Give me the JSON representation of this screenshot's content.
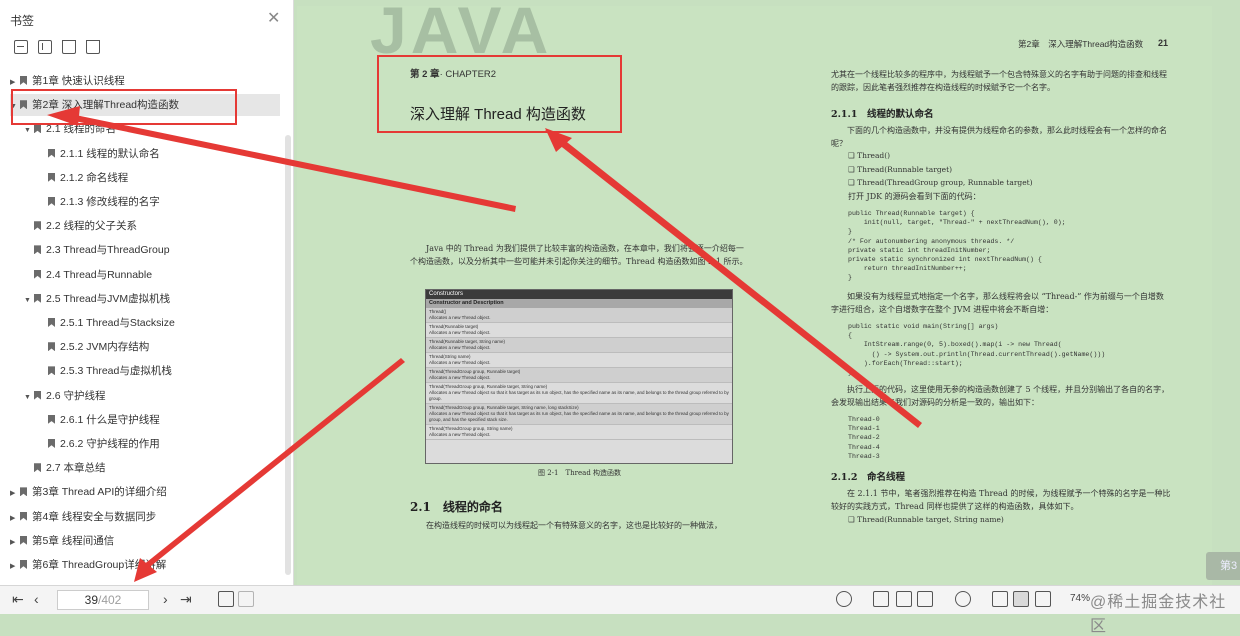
{
  "sidebar": {
    "title": "书签",
    "toc": [
      {
        "label": "第1章 快速认识线程",
        "level": 0,
        "expanded": false
      },
      {
        "label": "第2章 深入理解Thread构造函数",
        "level": 0,
        "expanded": true,
        "selected": true
      },
      {
        "label": "2.1 线程的命名",
        "level": 1,
        "expanded": true
      },
      {
        "label": "2.1.1 线程的默认命名",
        "level": 2
      },
      {
        "label": "2.1.2 命名线程",
        "level": 2
      },
      {
        "label": "2.1.3 修改线程的名字",
        "level": 2
      },
      {
        "label": "2.2 线程的父子关系",
        "level": 1
      },
      {
        "label": "2.3 Thread与ThreadGroup",
        "level": 1
      },
      {
        "label": "2.4 Thread与Runnable",
        "level": 1
      },
      {
        "label": "2.5 Thread与JVM虚拟机栈",
        "level": 1,
        "expanded": true
      },
      {
        "label": "2.5.1 Thread与Stacksize",
        "level": 2
      },
      {
        "label": "2.5.2 JVM内存结构",
        "level": 2
      },
      {
        "label": "2.5.3 Thread与虚拟机栈",
        "level": 2
      },
      {
        "label": "2.6 守护线程",
        "level": 1,
        "expanded": true
      },
      {
        "label": "2.6.1 什么是守护线程",
        "level": 2
      },
      {
        "label": "2.6.2 守护线程的作用",
        "level": 2
      },
      {
        "label": "2.7 本章总结",
        "level": 1
      },
      {
        "label": "第3章 Thread API的详细介绍",
        "level": 0,
        "expanded": false
      },
      {
        "label": "第4章 线程安全与数据同步",
        "level": 0,
        "expanded": false
      },
      {
        "label": "第5章 线程间通信",
        "level": 0,
        "expanded": false
      },
      {
        "label": "第6章 ThreadGroup详细讲解",
        "level": 0,
        "expanded": false
      }
    ]
  },
  "page": {
    "watermark": "JAVA",
    "running_head": "第2章　深入理解Thread构造函数",
    "page_number": "21",
    "chapter_label": "第 2 章",
    "chapter_en": "· CHAPTER2",
    "chapter_title": "深入理解 Thread 构造函数",
    "intro": "Java 中的 Thread 为我们提供了比较丰富的构造函数，在本章中，我们将会逐一介绍每一个构造函数，以及分析其中一些可能并未引起你关注的细节。Thread 构造函数如图 2-1 所示。",
    "figure": {
      "header": "Constructors",
      "subheader": "Constructor and Description",
      "rows": [
        "Thread()\nAllocates a new Thread object.",
        "Thread(Runnable target)\nAllocates a new Thread object.",
        "Thread(Runnable target, String name)\nAllocates a new Thread object.",
        "Thread(String name)\nAllocates a new Thread object.",
        "Thread(ThreadGroup group, Runnable target)\nAllocates a new Thread object.",
        "Thread(ThreadGroup group, Runnable target, String name)\nAllocates a new Thread object so that it has target as its run object, has the specified name as its name, and belongs to the thread group referred to by group.",
        "Thread(ThreadGroup group, Runnable target, String name, long stackSize)\nAllocates a new Thread object so that it has target as its run object, has the specified name as its name, and belongs to the thread group referred to by group, and has the specified stack size.",
        "Thread(ThreadGroup group, String name)\nAllocates a new Thread object."
      ],
      "caption": "图 2-1　Thread 构造函数"
    },
    "sec_2_1": "2.1　线程的命名",
    "sec_2_1_text": "在构造线程的时候可以为线程起一个有特殊意义的名字，这也是比较好的一种做法，",
    "right_intro": "尤其在一个线程比较多的程序中，为线程赋予一个包含特殊意义的名字有助于问题的排查和线程的跟踪，因此笔者强烈推荐在构造线程的时候赋予它一个名字。",
    "sec_2_1_1": "2.1.1　线程的默认命名",
    "sec_2_1_1_text": "下面的几个构造函数中，并没有提供为线程命名的参数，那么此时线程会有一个怎样的命名呢？",
    "bullets": [
      "Thread()",
      "Thread(Runnable target)",
      "Thread(ThreadGroup group, Runnable target)"
    ],
    "jdk_line": "打开 JDK 的源码会看到下面的代码：",
    "code1": "public Thread(Runnable target) {\n    init(null, target, \"Thread-\" + nextThreadNum(), 0);\n}\n/* For autonumbering anonymous threads. */\nprivate static int threadInitNumber;\nprivate static synchronized int nextThreadNum() {\n    return threadInitNumber++;\n}",
    "mid_text": "如果没有为线程显式地指定一个名字，那么线程将会以 “Thread-” 作为前缀与一个自增数字进行组合，这个自增数字在整个 JVM 进程中将会不断自增：",
    "code2": "public static void main(String[] args)\n{\n    IntStream.range(0, 5).boxed().map(i -> new Thread(\n      () -> System.out.println(Thread.currentThread().getName()))\n    ).forEach(Thread::start);\n}",
    "exec_text": "执行上面的代码，这里使用无参的构造函数创建了 5 个线程，并且分别输出了各自的名字，会发现输出结果与我们对源码的分析是一致的，输出如下：",
    "output": "Thread-0\nThread-1\nThread-2\nThread-4\nThread-3",
    "sec_2_1_2": "2.1.2　命名线程",
    "sec_2_1_2_text": "在 2.1.1 节中，笔者强烈推荐在构造 Thread 的时候，为线程赋予一个特殊的名字是一种比较好的实践方式，Thread 同样也提供了这样的构造函数，具体如下。",
    "bullet_last": "Thread(Runnable target, String name)",
    "side_button": "第3"
  },
  "status": {
    "current_page": "39",
    "total_pages": "/402",
    "zoom": "74%",
    "watermark": "@稀土掘金技术社区"
  },
  "colors": {
    "annotation_red": "#e53935",
    "page_bg": "#c9e3c1"
  }
}
